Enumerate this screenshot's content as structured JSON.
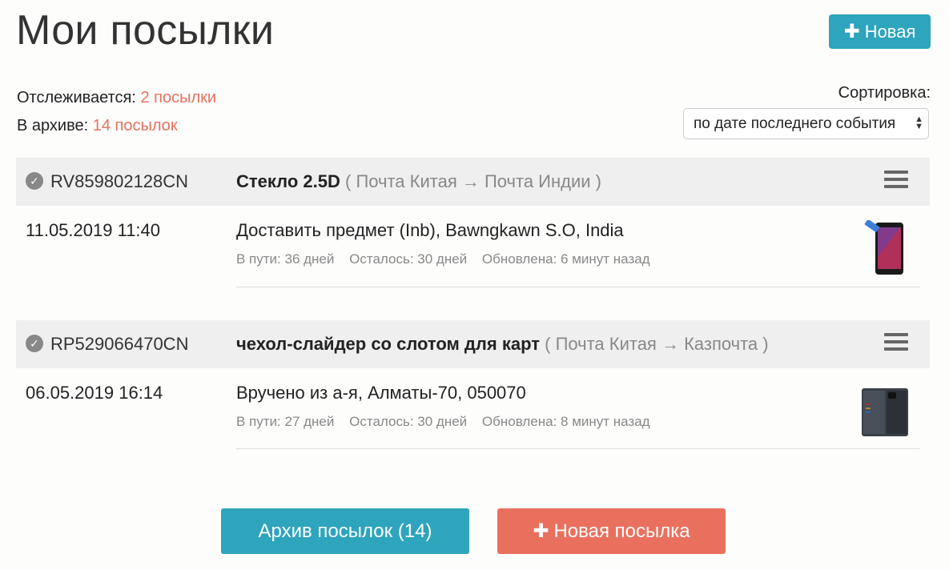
{
  "header": {
    "title": "Мои посылки",
    "new_button_label": "Новая"
  },
  "summary": {
    "tracking_label": "Отслеживается:",
    "tracking_value": "2 посылки",
    "archive_label": "В архиве:",
    "archive_value": "14 посылок"
  },
  "sort": {
    "label": "Сортировка:",
    "selected": "по дате последнего события"
  },
  "parcels": [
    {
      "track": "RV859802128CN",
      "name": "Стекло 2.5D",
      "route": "( Почта Китая → Почта Индии )",
      "date": "11.05.2019 11:40",
      "event": "Доставить предмет (Inb), Bawngkawn S.O, India",
      "in_transit": "В пути: 36 дней",
      "remaining": "Осталось: 30 дней",
      "updated": "Обновлена: 6 минут назад"
    },
    {
      "track": "RP529066470CN",
      "name": "чехол-слайдер со слотом для карт",
      "route": "( Почта Китая → Казпочта )",
      "date": "06.05.2019 16:14",
      "event": "Вручено из а-я, Алматы-70, 050070",
      "in_transit": "В пути: 27 дней",
      "remaining": "Осталось: 30 дней",
      "updated": "Обновлена: 8 минут назад"
    }
  ],
  "footer": {
    "archive_button": "Архив посылок (14)",
    "new_parcel_button": "Новая посылка"
  },
  "colors": {
    "accent_teal": "#2ea4bd",
    "accent_coral": "#ea705e"
  }
}
